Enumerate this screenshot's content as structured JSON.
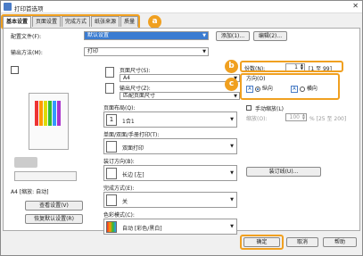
{
  "window": {
    "title": "打印首选项"
  },
  "tabs": [
    {
      "label": "基本设置",
      "active": true
    },
    {
      "label": "页面设置"
    },
    {
      "label": "完成方式"
    },
    {
      "label": "纸张来源"
    },
    {
      "label": "质量"
    }
  ],
  "callouts": {
    "a": "a",
    "b": "b",
    "c": "c"
  },
  "profile": {
    "label": "配置文件(F):",
    "value": "默认设置",
    "add_label": "添加(1)...",
    "edit_label": "编辑(2)..."
  },
  "output": {
    "label": "输出方法(M):",
    "value": "打印"
  },
  "page_size": {
    "label": "页面尺寸(S):",
    "value": "A4"
  },
  "output_size": {
    "label": "输出尺寸(Z):",
    "value": "匹配页面尺寸"
  },
  "copies": {
    "label": "份数(N):",
    "value": "1",
    "range": "[1 至 99]"
  },
  "orientation": {
    "label": "方向(O)",
    "options": [
      {
        "label": "纵向",
        "selected": true
      },
      {
        "label": "横向",
        "selected": false
      }
    ]
  },
  "layout": {
    "label": "页面布局(Q):",
    "value": "1合1"
  },
  "manual_scale": {
    "label": "手动缩放(L)",
    "scale_label": "缩放(O):",
    "value": "100",
    "unit": "% [25 至 200]"
  },
  "duplex": {
    "label": "单面/双面/手册打印(T):",
    "value": "双面打印"
  },
  "binding": {
    "label": "装订方向(B):",
    "value": "长边 [左]",
    "margin_button": "装订线(U)..."
  },
  "finishing": {
    "label": "完成方式(E):",
    "value": "关"
  },
  "color_mode": {
    "label": "色彩模式(C):",
    "value": "自动 [彩色/黑白]"
  },
  "preview": {
    "caption": "A4 [缩放: 自动]",
    "view_settings": "查看设置(V)",
    "restore_defaults": "恢复默认设置(R)"
  },
  "footer": {
    "ok": "确定",
    "cancel": "取消",
    "help": "帮助"
  },
  "colors": {
    "accent": "#f0a020",
    "selection": "#3b7cd1"
  }
}
